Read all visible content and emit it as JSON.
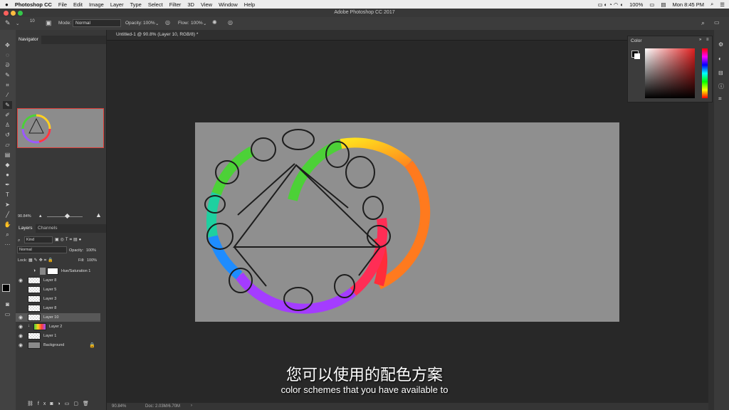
{
  "menubar": {
    "app": "Photoshop CC",
    "items": [
      "File",
      "Edit",
      "Image",
      "Layer",
      "Type",
      "Select",
      "Filter",
      "3D",
      "View",
      "Window",
      "Help"
    ],
    "battery": "100%",
    "clock": "Mon 8:45 PM"
  },
  "window": {
    "title": "Adobe Photoshop CC 2017"
  },
  "options": {
    "brush_size": "10",
    "mode_label": "Mode:",
    "mode_value": "Normal",
    "opacity_label": "Opacity:",
    "opacity_value": "100%",
    "flow_label": "Flow:",
    "flow_value": "100%"
  },
  "document": {
    "tab_title": "Untitled-1 @ 90.8% (Layer 10, RGB/8) *"
  },
  "navigator": {
    "title": "Navigator",
    "zoom": "90.84%"
  },
  "layers_panel": {
    "tabs": [
      "Layers",
      "Channels"
    ],
    "filter_label": "Kind",
    "blend_mode": "Normal",
    "opacity_label": "Opacity:",
    "opacity_value": "100%",
    "lock_label": "Lock:",
    "fill_label": "Fill:",
    "fill_value": "100%",
    "layers": [
      {
        "name": "Hue/Saturation 1",
        "visible": false,
        "selected": false
      },
      {
        "name": "Layer 8",
        "visible": true,
        "selected": false
      },
      {
        "name": "Layer 5",
        "visible": false,
        "selected": false
      },
      {
        "name": "Layer 3",
        "visible": false,
        "selected": false
      },
      {
        "name": "Layer 8",
        "visible": false,
        "selected": false
      },
      {
        "name": "Layer 10",
        "visible": true,
        "selected": true
      },
      {
        "name": "Layer 2",
        "visible": true,
        "selected": false
      },
      {
        "name": "Layer 1",
        "visible": true,
        "selected": false
      },
      {
        "name": "Background",
        "visible": true,
        "selected": false
      }
    ]
  },
  "color_panel": {
    "title": "Color"
  },
  "status": {
    "zoom": "90.84%",
    "doc": "Doc: 2.03M/6.70M"
  },
  "subtitles": {
    "chinese": "您可以使用的配色方案",
    "english": "color schemes that you have available to"
  },
  "colors": {
    "accent_selected": "#585858",
    "navigator_box": "#e0403a"
  }
}
